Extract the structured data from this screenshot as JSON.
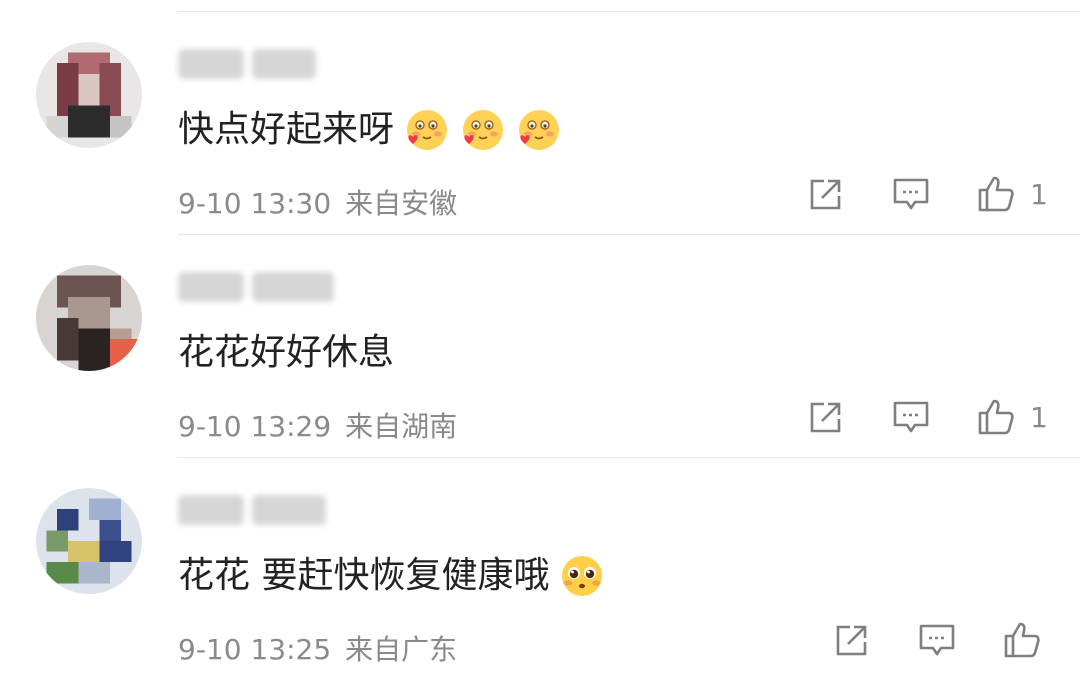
{
  "colors": {
    "text": "#222222",
    "meta": "#8a8a8a",
    "divider": "#e8e8e8",
    "icon": "#7f7f7f"
  },
  "comments": [
    {
      "content": "快点好起来呀",
      "emojis": [
        "blush-heart-emoji",
        "blush-heart-emoji",
        "blush-heart-emoji"
      ],
      "time": "9-10 13:30",
      "location": "来自安徽",
      "likes": "1"
    },
    {
      "content": "花花好好休息",
      "emojis": [],
      "time": "9-10 13:29",
      "location": "来自湖南",
      "likes": "1"
    },
    {
      "content": "花花 要赶快恢复健康哦",
      "emojis": [
        "pleading-face-emoji"
      ],
      "time": "9-10 13:25",
      "location": "来自广东",
      "likes": ""
    }
  ]
}
